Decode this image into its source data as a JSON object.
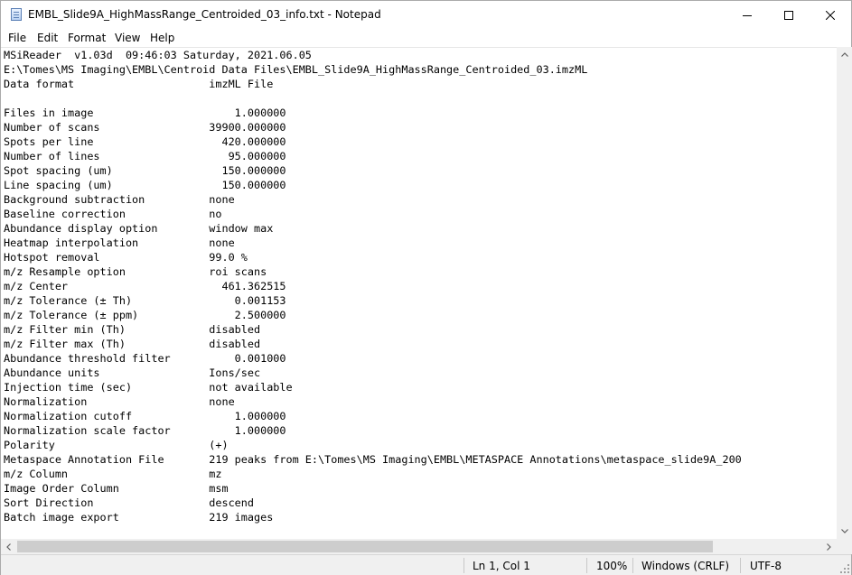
{
  "window": {
    "title": "EMBL_Slide9A_HighMassRange_Centroided_03_info.txt - Notepad",
    "icon": "notepad-icon"
  },
  "menu": [
    "File",
    "Edit",
    "Format",
    "View",
    "Help"
  ],
  "editor_lines": [
    "MSiReader  v1.03d  09:46:03 Saturday, 2021.06.05",
    "E:\\Tomes\\MS Imaging\\EMBL\\Centroid Data Files\\EMBL_Slide9A_HighMassRange_Centroided_03.imzML",
    "Data format                     imzML File",
    "",
    "Files in image                      1.000000",
    "Number of scans                 39900.000000",
    "Spots per line                    420.000000",
    "Number of lines                    95.000000",
    "Spot spacing (um)                 150.000000",
    "Line spacing (um)                 150.000000",
    "Background subtraction          none",
    "Baseline correction             no",
    "Abundance display option        window max",
    "Heatmap interpolation           none",
    "Hotspot removal                 99.0 %",
    "m/z Resample option             roi scans",
    "m/z Center                        461.362515",
    "m/z Tolerance (± Th)                0.001153",
    "m/z Tolerance (± ppm)               2.500000",
    "m/z Filter min (Th)             disabled",
    "m/z Filter max (Th)             disabled",
    "Abundance threshold filter          0.001000",
    "Abundance units                 Ions/sec",
    "Injection time (sec)            not available",
    "Normalization                   none",
    "Normalization cutoff                1.000000",
    "Normalization scale factor          1.000000",
    "Polarity                        (+)",
    "Metaspace Annotation File       219 peaks from E:\\Tomes\\MS Imaging\\EMBL\\METASPACE Annotations\\metaspace_slide9A_200",
    "m/z Column                      mz",
    "Image Order Column              msm",
    "Sort Direction                  descend",
    "Batch image export              219 images"
  ],
  "status": {
    "position": "Ln 1, Col 1",
    "zoom": "100%",
    "line_ending": "Windows (CRLF)",
    "encoding": "UTF-8"
  },
  "colors": {
    "chrome": "#f0f0f0",
    "scroll_thumb": "#cdcdcd"
  }
}
